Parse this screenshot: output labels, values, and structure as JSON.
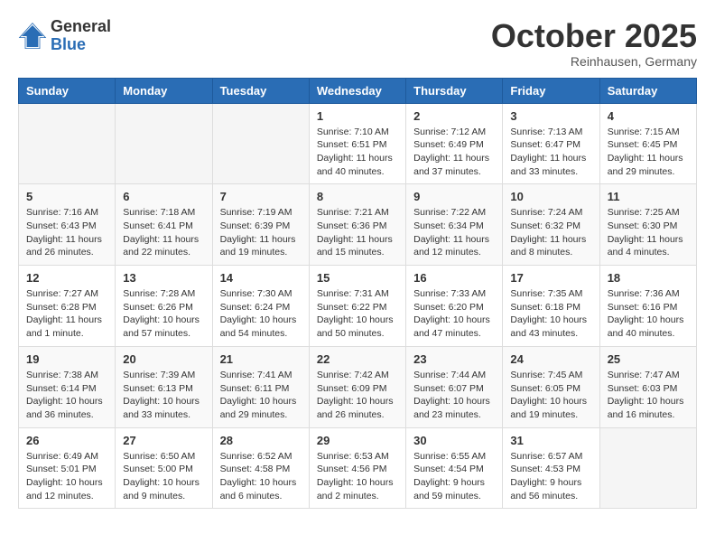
{
  "logo": {
    "general": "General",
    "blue": "Blue"
  },
  "title": "October 2025",
  "location": "Reinhausen, Germany",
  "days_of_week": [
    "Sunday",
    "Monday",
    "Tuesday",
    "Wednesday",
    "Thursday",
    "Friday",
    "Saturday"
  ],
  "weeks": [
    [
      {
        "day": "",
        "info": ""
      },
      {
        "day": "",
        "info": ""
      },
      {
        "day": "",
        "info": ""
      },
      {
        "day": "1",
        "info": "Sunrise: 7:10 AM\nSunset: 6:51 PM\nDaylight: 11 hours\nand 40 minutes."
      },
      {
        "day": "2",
        "info": "Sunrise: 7:12 AM\nSunset: 6:49 PM\nDaylight: 11 hours\nand 37 minutes."
      },
      {
        "day": "3",
        "info": "Sunrise: 7:13 AM\nSunset: 6:47 PM\nDaylight: 11 hours\nand 33 minutes."
      },
      {
        "day": "4",
        "info": "Sunrise: 7:15 AM\nSunset: 6:45 PM\nDaylight: 11 hours\nand 29 minutes."
      }
    ],
    [
      {
        "day": "5",
        "info": "Sunrise: 7:16 AM\nSunset: 6:43 PM\nDaylight: 11 hours\nand 26 minutes."
      },
      {
        "day": "6",
        "info": "Sunrise: 7:18 AM\nSunset: 6:41 PM\nDaylight: 11 hours\nand 22 minutes."
      },
      {
        "day": "7",
        "info": "Sunrise: 7:19 AM\nSunset: 6:39 PM\nDaylight: 11 hours\nand 19 minutes."
      },
      {
        "day": "8",
        "info": "Sunrise: 7:21 AM\nSunset: 6:36 PM\nDaylight: 11 hours\nand 15 minutes."
      },
      {
        "day": "9",
        "info": "Sunrise: 7:22 AM\nSunset: 6:34 PM\nDaylight: 11 hours\nand 12 minutes."
      },
      {
        "day": "10",
        "info": "Sunrise: 7:24 AM\nSunset: 6:32 PM\nDaylight: 11 hours\nand 8 minutes."
      },
      {
        "day": "11",
        "info": "Sunrise: 7:25 AM\nSunset: 6:30 PM\nDaylight: 11 hours\nand 4 minutes."
      }
    ],
    [
      {
        "day": "12",
        "info": "Sunrise: 7:27 AM\nSunset: 6:28 PM\nDaylight: 11 hours\nand 1 minute."
      },
      {
        "day": "13",
        "info": "Sunrise: 7:28 AM\nSunset: 6:26 PM\nDaylight: 10 hours\nand 57 minutes."
      },
      {
        "day": "14",
        "info": "Sunrise: 7:30 AM\nSunset: 6:24 PM\nDaylight: 10 hours\nand 54 minutes."
      },
      {
        "day": "15",
        "info": "Sunrise: 7:31 AM\nSunset: 6:22 PM\nDaylight: 10 hours\nand 50 minutes."
      },
      {
        "day": "16",
        "info": "Sunrise: 7:33 AM\nSunset: 6:20 PM\nDaylight: 10 hours\nand 47 minutes."
      },
      {
        "day": "17",
        "info": "Sunrise: 7:35 AM\nSunset: 6:18 PM\nDaylight: 10 hours\nand 43 minutes."
      },
      {
        "day": "18",
        "info": "Sunrise: 7:36 AM\nSunset: 6:16 PM\nDaylight: 10 hours\nand 40 minutes."
      }
    ],
    [
      {
        "day": "19",
        "info": "Sunrise: 7:38 AM\nSunset: 6:14 PM\nDaylight: 10 hours\nand 36 minutes."
      },
      {
        "day": "20",
        "info": "Sunrise: 7:39 AM\nSunset: 6:13 PM\nDaylight: 10 hours\nand 33 minutes."
      },
      {
        "day": "21",
        "info": "Sunrise: 7:41 AM\nSunset: 6:11 PM\nDaylight: 10 hours\nand 29 minutes."
      },
      {
        "day": "22",
        "info": "Sunrise: 7:42 AM\nSunset: 6:09 PM\nDaylight: 10 hours\nand 26 minutes."
      },
      {
        "day": "23",
        "info": "Sunrise: 7:44 AM\nSunset: 6:07 PM\nDaylight: 10 hours\nand 23 minutes."
      },
      {
        "day": "24",
        "info": "Sunrise: 7:45 AM\nSunset: 6:05 PM\nDaylight: 10 hours\nand 19 minutes."
      },
      {
        "day": "25",
        "info": "Sunrise: 7:47 AM\nSunset: 6:03 PM\nDaylight: 10 hours\nand 16 minutes."
      }
    ],
    [
      {
        "day": "26",
        "info": "Sunrise: 6:49 AM\nSunset: 5:01 PM\nDaylight: 10 hours\nand 12 minutes."
      },
      {
        "day": "27",
        "info": "Sunrise: 6:50 AM\nSunset: 5:00 PM\nDaylight: 10 hours\nand 9 minutes."
      },
      {
        "day": "28",
        "info": "Sunrise: 6:52 AM\nSunset: 4:58 PM\nDaylight: 10 hours\nand 6 minutes."
      },
      {
        "day": "29",
        "info": "Sunrise: 6:53 AM\nSunset: 4:56 PM\nDaylight: 10 hours\nand 2 minutes."
      },
      {
        "day": "30",
        "info": "Sunrise: 6:55 AM\nSunset: 4:54 PM\nDaylight: 9 hours\nand 59 minutes."
      },
      {
        "day": "31",
        "info": "Sunrise: 6:57 AM\nSunset: 4:53 PM\nDaylight: 9 hours\nand 56 minutes."
      },
      {
        "day": "",
        "info": ""
      }
    ]
  ]
}
